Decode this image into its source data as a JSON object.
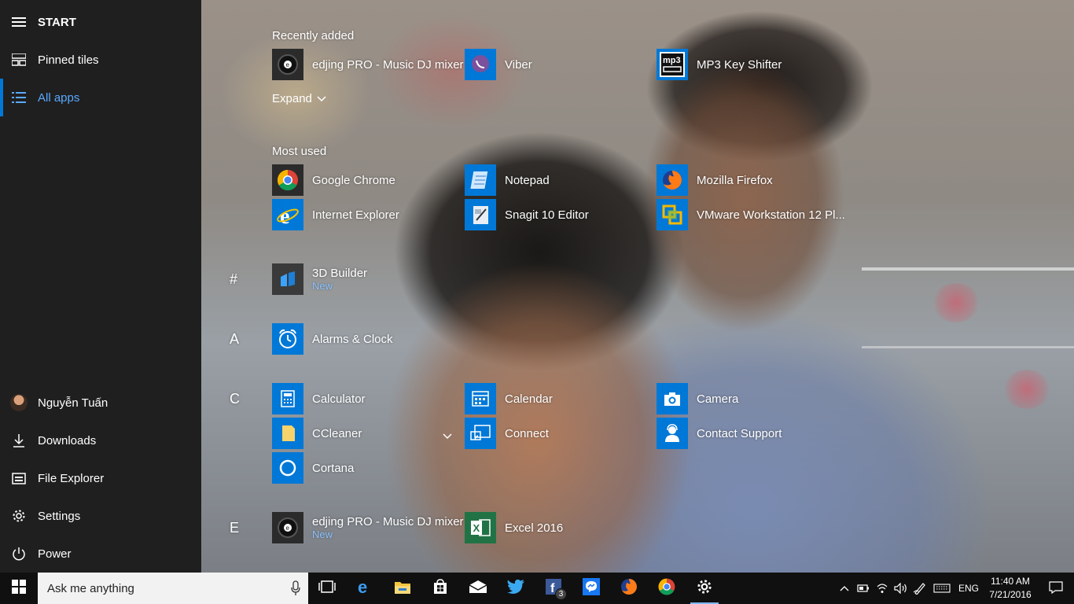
{
  "rail": {
    "start_label": "START",
    "pinned_tiles": "Pinned tiles",
    "all_apps": "All apps",
    "user_name": "Nguyễn Tuấn",
    "downloads": "Downloads",
    "file_explorer": "File Explorer",
    "settings": "Settings",
    "power": "Power"
  },
  "recently_added": {
    "header": "Recently added",
    "apps": [
      "edjing PRO - Music DJ mixer",
      "Viber",
      "MP3 Key Shifter"
    ],
    "expand": "Expand"
  },
  "most_used": {
    "header": "Most used",
    "apps": [
      "Google Chrome",
      "Notepad",
      "Mozilla Firefox",
      "Internet Explorer",
      "Snagit 10 Editor",
      "VMware Workstation 12 Pl..."
    ]
  },
  "groups": {
    "hash": {
      "letter": "#",
      "apps": [
        {
          "label": "3D Builder",
          "sub": "New"
        }
      ]
    },
    "a": {
      "letter": "A",
      "apps": [
        {
          "label": "Alarms & Clock"
        }
      ]
    },
    "c": {
      "letter": "C",
      "apps": [
        {
          "label": "Calculator"
        },
        {
          "label": "Calendar"
        },
        {
          "label": "Camera"
        },
        {
          "label": "CCleaner"
        },
        {
          "label": "Connect"
        },
        {
          "label": "Contact Support"
        },
        {
          "label": "Cortana"
        }
      ]
    },
    "e": {
      "letter": "E",
      "apps": [
        {
          "label": "edjing PRO - Music DJ mixer",
          "sub": "New"
        },
        {
          "label": "Excel 2016"
        }
      ]
    }
  },
  "taskbar": {
    "search_placeholder": "Ask me anything",
    "facebook_badge": "3",
    "language": "ENG",
    "time": "11:40 AM",
    "date": "7/21/2016"
  },
  "colors": {
    "accent": "#0078d7",
    "rail_bg": "#1f1f1f",
    "taskbar_bg": "#101010"
  }
}
